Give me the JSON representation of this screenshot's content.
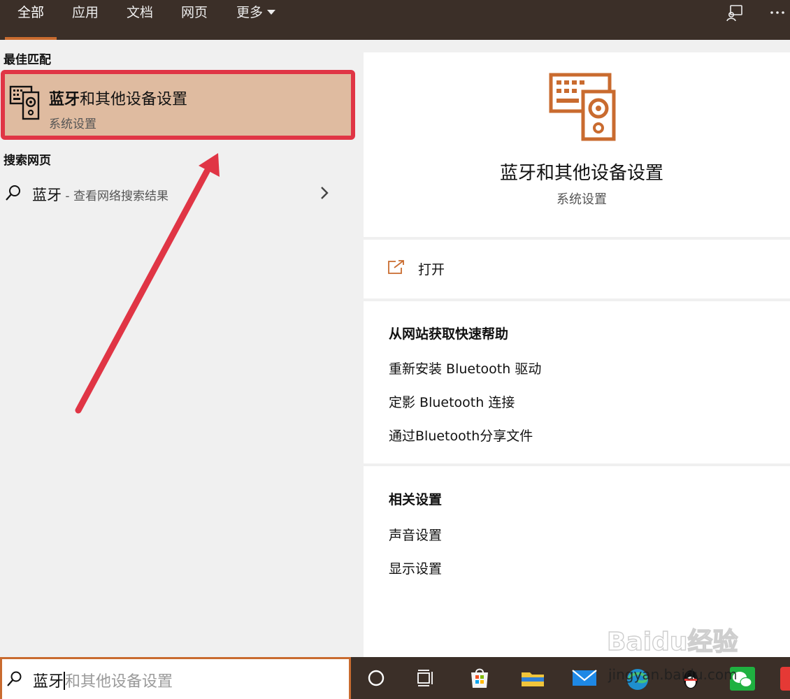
{
  "tabs": [
    {
      "label": "全部",
      "active": true
    },
    {
      "label": "应用",
      "active": false
    },
    {
      "label": "文档",
      "active": false
    },
    {
      "label": "网页",
      "active": false
    },
    {
      "label": "更多",
      "active": false
    }
  ],
  "topbar_icons": [
    "feedback-icon",
    "more-options-icon"
  ],
  "left_panel": {
    "best_match_heading": "最佳匹配",
    "best_match": {
      "title_bold": "蓝牙",
      "title_rest": "和其他设备设置",
      "subtitle": "系统设置",
      "icon": "devices-icon"
    },
    "web_heading": "搜索网页",
    "web_result": {
      "query": "蓝牙",
      "suffix": " - 查看网络搜索结果",
      "icon": "search-icon"
    }
  },
  "right_panel": {
    "title": "蓝牙和其他设备设置",
    "subtitle": "系统设置",
    "open_label": "打开",
    "help_heading": "从网站获取快速帮助",
    "help_links": [
      "重新安装 Bluetooth 驱动",
      "定影 Bluetooth 连接",
      "通过Bluetooth分享文件"
    ],
    "related_heading": "相关设置",
    "related_links": [
      "声音设置",
      "显示设置"
    ]
  },
  "search_box": {
    "typed": "蓝牙",
    "suggestion": "和其他设备设置"
  },
  "taskbar": [
    "cortana-icon",
    "task-view-icon",
    "store-icon",
    "file-explorer-icon",
    "mail-icon",
    "edge-icon",
    "qq-icon",
    "wechat-icon",
    "app-icon"
  ],
  "watermark": {
    "text": "Baidu经验",
    "url_text": "jingyan.baidu.com"
  },
  "colors": {
    "accent": "#c96b2f",
    "topbar": "#3b2f28",
    "highlight_border": "#e03545",
    "selected_bg": "#dfbba0"
  }
}
